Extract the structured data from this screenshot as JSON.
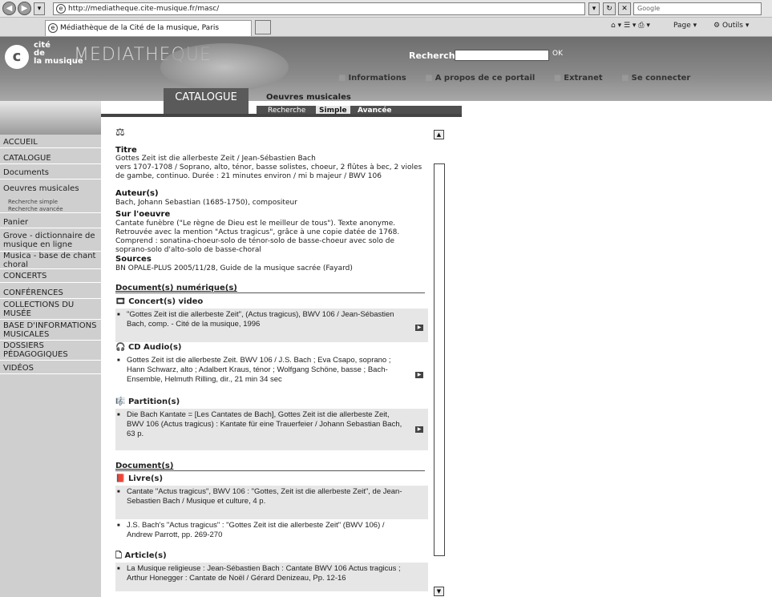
{
  "browser": {
    "url": "http://mediatheque.cite-musique.fr/masc/",
    "search_placeholder": "Google",
    "tab_title": "Médiathèque de la Cité de la musique, Paris",
    "toolbar_page": "Page",
    "toolbar_tools": "Outils"
  },
  "site": {
    "logo_line1": "cité",
    "logo_line2": "de",
    "logo_line3": "la musique",
    "brand": "MEDIATHEQUE",
    "search_label": "Recherche",
    "ok_label": "OK",
    "top_links": [
      "Informations",
      "A propos de ce portail",
      "Extranet",
      "Se connecter"
    ]
  },
  "nav": {
    "items": [
      "ACCUEIL",
      "CATALOGUE",
      "Documents",
      "Oeuvres musicales"
    ],
    "sub_items": [
      "Recherche simple",
      "Recherche avancée"
    ],
    "items2": [
      "Panier",
      "Grove - dictionnaire de musique en ligne",
      "Musica - base de chant choral",
      "CONCERTS",
      "CONFÉRENCES",
      "COLLECTIONS DU MUSÉE",
      "BASE D'INFORMATIONS MUSICALES",
      "DOSSIERS PÉDAGOGIQUES",
      "VIDÉOS"
    ]
  },
  "catalogue": {
    "tab": "CATALOGUE",
    "section": "Oeuvres musicales",
    "subtabs": [
      "Recherche",
      "Simple",
      "Avancée"
    ]
  },
  "record": {
    "titre_label": "Titre",
    "titre": "Gottes Zeit ist die allerbeste Zeit / Jean-Sébastien Bach",
    "titre_detail": "vers 1707-1708 / Soprano, alto, ténor, basse solistes, choeur, 2 flûtes à bec, 2 violes de gambe, continuo. Durée : 21 minutes environ / mi b majeur / BWV 106",
    "auteurs_label": "Auteur(s)",
    "auteurs": "Bach, Johann Sebastian (1685-1750), compositeur",
    "sur_label": "Sur l'oeuvre",
    "sur": "Cantate funèbre (\"Le règne de Dieu est le meilleur de tous\"). Texte anonyme. Retrouvée avec la mention \"Actus tragicus\", grâce à une copie datée de 1768. Comprend : sonatina-choeur-solo de ténor-solo de basse-choeur avec solo de soprano-solo d'alto-solo de basse-choral",
    "sources_label": "Sources",
    "sources": "BN OPALE-PLUS 2005/11/28, Guide de la musique sacrée (Fayard)"
  },
  "numeriques": {
    "header": "Document(s) numérique(s)",
    "concert_label": "Concert(s) video",
    "concert_item": "\"Gottes Zeit ist die allerbeste Zeit\", (Actus tragicus), BWV 106 / Jean-Sébastien Bach, comp. - Cité de la musique, 1996",
    "cd_label": "CD Audio(s)",
    "cd_item": "Gottes Zeit ist die allerbeste Zeit. BWV 106 / J.S. Bach ; Eva Csapo, soprano ; Hann Schwarz, alto ; Adalbert Kraus, ténor ; Wolfgang Schöne, basse ; Bach-Ensemble, Helmuth Rilling, dir., 21 min 34 sec",
    "partition_label": "Partition(s)",
    "partition_item": "Die Bach Kantate = [Les Cantates de Bach], Gottes Zeit ist die allerbeste Zeit, BWV 106 (Actus tragicus) : Kantate für eine Trauerfeier / Johann Sebastian Bach, 63 p."
  },
  "documents": {
    "header": "Document(s)",
    "livre_label": "Livre(s)",
    "livre_item1": "Cantate \"Actus tragicus\", BWV 106 : \"Gottes, Zeit ist die allerbeste Zeit\", de Jean-Sebastien Bach / Musique et culture, 4 p.",
    "livre_item2": "J.S. Bach's \"Actus tragicus\" : \"Gottes Zeit ist die allerbeste Zeit\" (BWV 106) / Andrew Parrott, pp. 269-270",
    "article_label": "Article(s)",
    "article_item": "La Musique religieuse : Jean-Sébastien Bach : Cantate BWV 106 Actus tragicus ; Arthur Honegger : Cantate de Noël / Gérard Denizeau, Pp. 12-16"
  }
}
